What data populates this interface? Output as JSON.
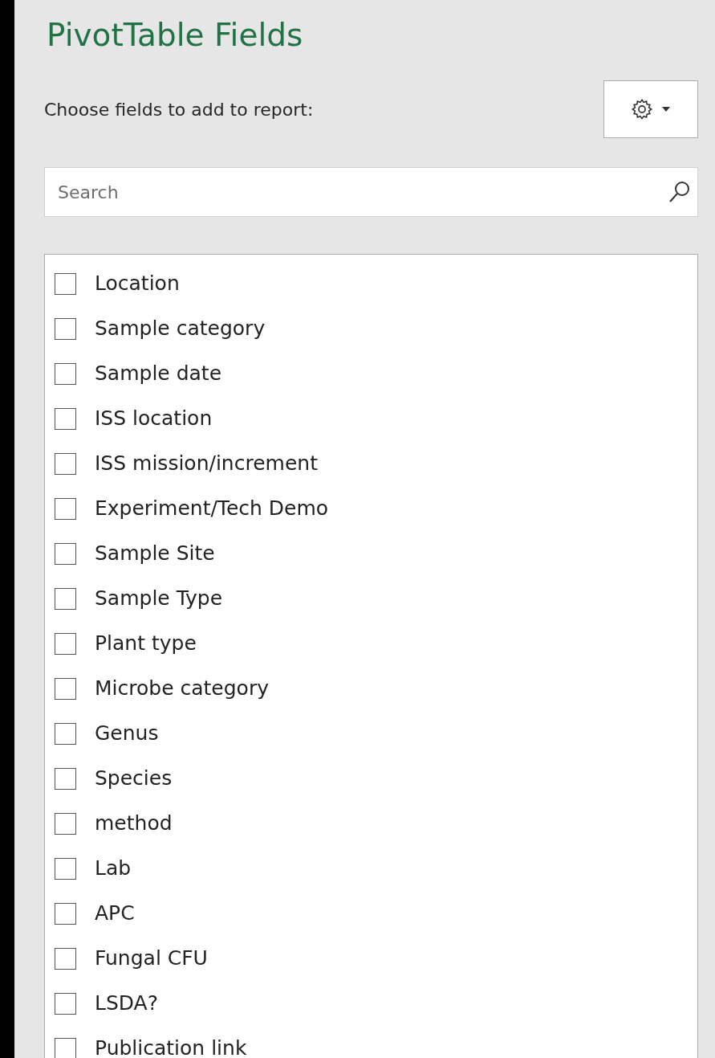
{
  "title": "PivotTable Fields",
  "prompt": "Choose fields to add to report:",
  "search": {
    "placeholder": "Search"
  },
  "fields": [
    {
      "label": "Location",
      "checked": false
    },
    {
      "label": "Sample category",
      "checked": false
    },
    {
      "label": "Sample date",
      "checked": false
    },
    {
      "label": "ISS location",
      "checked": false
    },
    {
      "label": "ISS mission/increment",
      "checked": false
    },
    {
      "label": "Experiment/Tech Demo",
      "checked": false
    },
    {
      "label": "Sample Site",
      "checked": false
    },
    {
      "label": "Sample Type",
      "checked": false
    },
    {
      "label": "Plant type",
      "checked": false
    },
    {
      "label": "Microbe category",
      "checked": false
    },
    {
      "label": "Genus",
      "checked": false
    },
    {
      "label": "Species",
      "checked": false
    },
    {
      "label": "method",
      "checked": false
    },
    {
      "label": "Lab",
      "checked": false
    },
    {
      "label": "APC",
      "checked": false
    },
    {
      "label": "Fungal CFU",
      "checked": false
    },
    {
      "label": "LSDA?",
      "checked": false
    },
    {
      "label": "Publication link",
      "checked": false
    }
  ]
}
